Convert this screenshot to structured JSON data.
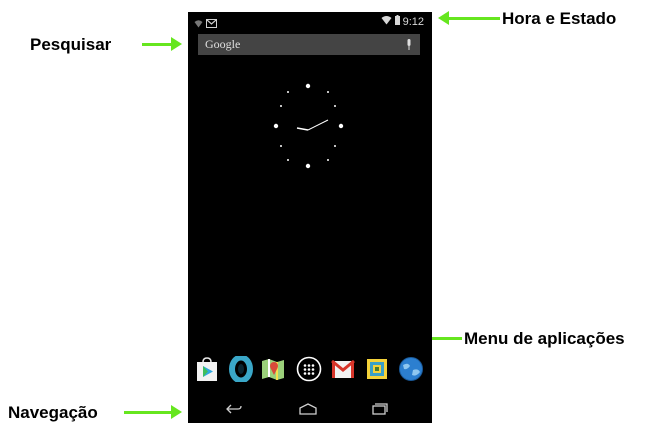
{
  "callouts": {
    "search": "Pesquisar",
    "status": "Hora e Estado",
    "app_menu": "Menu de aplicações",
    "navigation": "Navegação"
  },
  "status_bar": {
    "time": "9:12",
    "left_icons": [
      "wifi-question-icon",
      "gmail-notification-icon"
    ],
    "right_icons": [
      "wifi-icon",
      "battery-icon"
    ]
  },
  "search_bar": {
    "label": "Google",
    "icon": "mic-icon"
  },
  "dock": {
    "apps": [
      "play-store-icon",
      "browser-ring-icon",
      "maps-icon",
      "app-drawer-icon",
      "gmail-icon",
      "gallery-icon",
      "globe-icon"
    ]
  },
  "navigation": {
    "buttons": [
      "back-icon",
      "home-icon",
      "recents-icon"
    ]
  },
  "colors": {
    "arrow": "#66e61f",
    "screen": "#000000",
    "search_bar": "#444444"
  }
}
